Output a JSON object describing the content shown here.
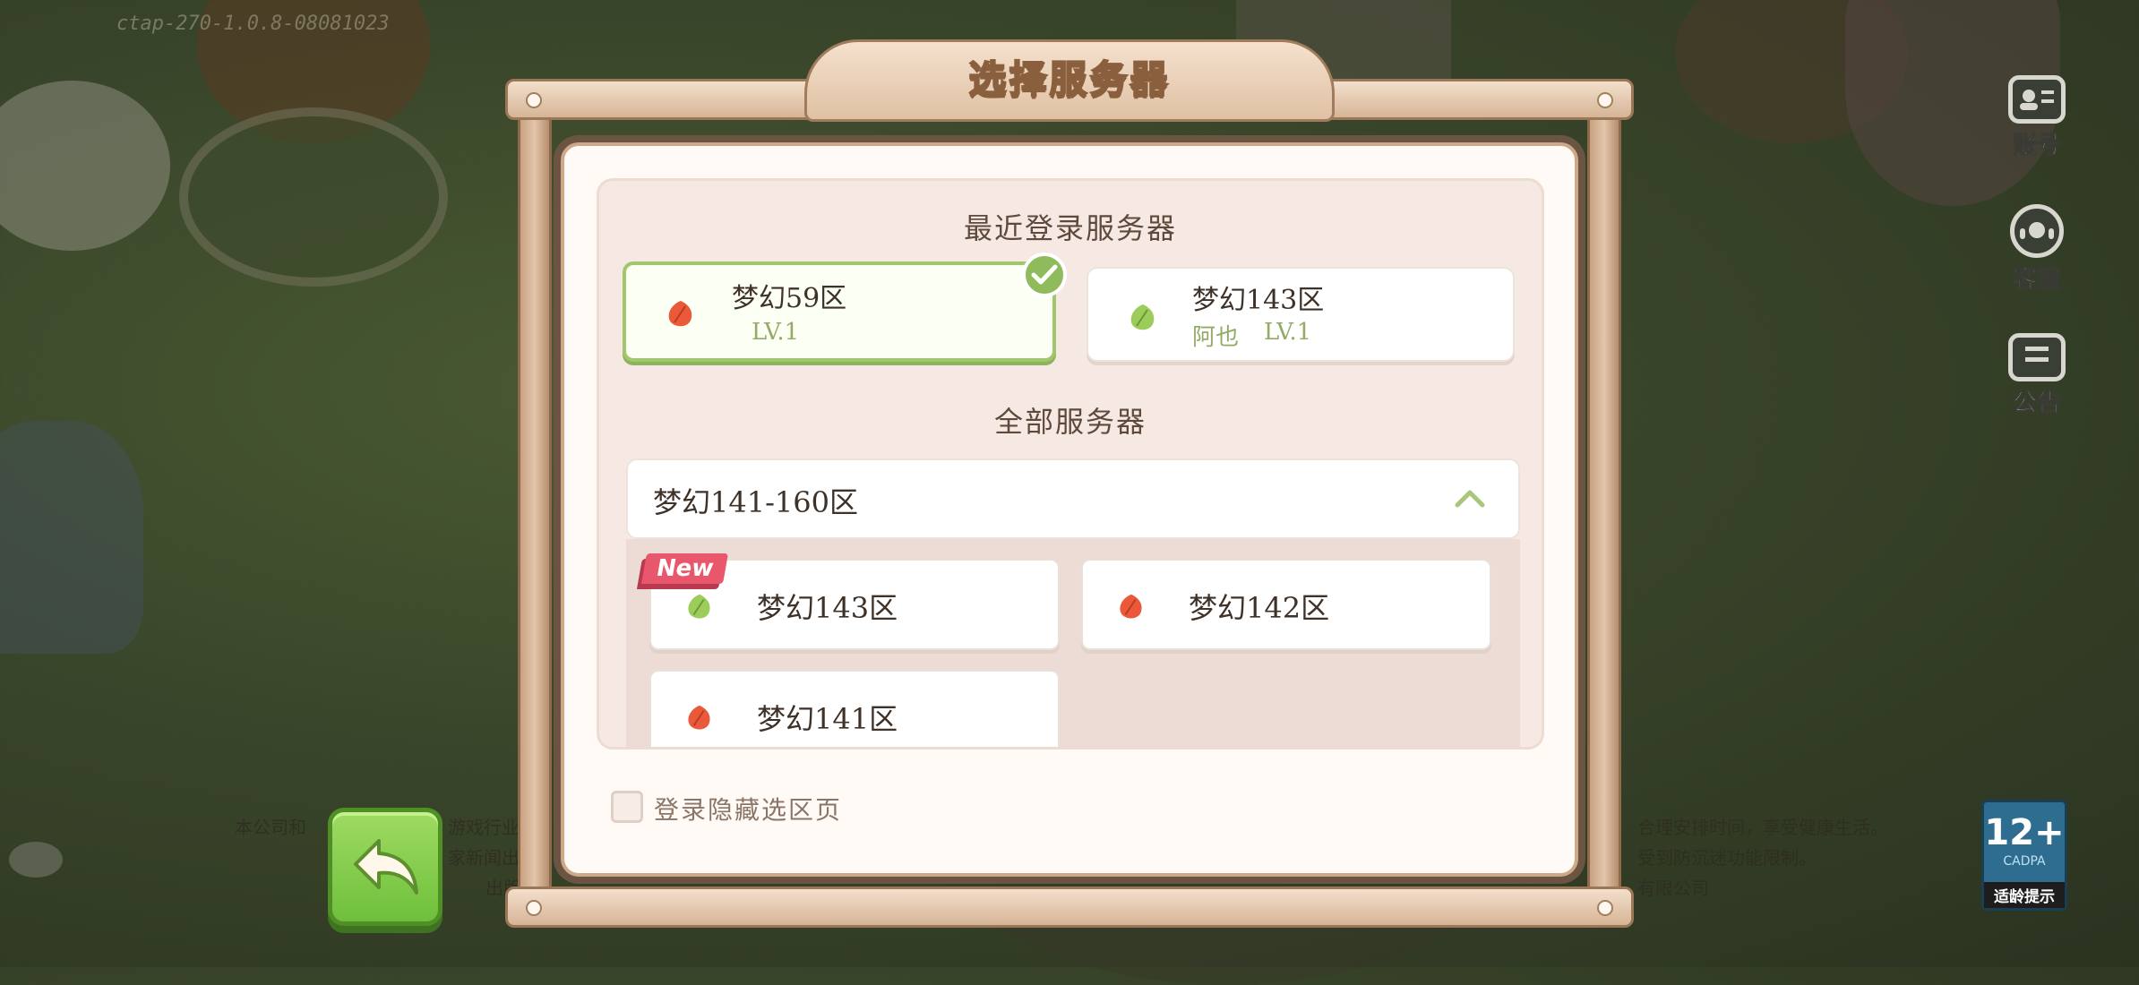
{
  "version": "ctap-270-1.0.8-08081023",
  "disclaimer": {
    "left_line1": "本公司和",
    "left_line1b": "游戏行业",
    "left_line2": "家新闻出",
    "left_line3": "出版",
    "right_line1": "合理安排时间，享受健康生活。",
    "right_line2": "受到防沉迷功能限制。",
    "right_line3": "有限公司"
  },
  "side_menu": {
    "account": "账号",
    "service": "客服",
    "notice": "公告"
  },
  "age_rating": {
    "number": "12+",
    "org": "CADPA",
    "tip": "适龄提示"
  },
  "dialog": {
    "title": "选择服务器",
    "recent_title": "最近登录服务器",
    "recent": [
      {
        "name": "梦幻59区",
        "level": "LV.1",
        "player": "",
        "leaf": "red",
        "selected": true
      },
      {
        "name": "梦幻143区",
        "level": "LV.1",
        "player": "阿也",
        "leaf": "green",
        "selected": false
      }
    ],
    "all_title": "全部服务器",
    "group_label": "梦幻141-160区",
    "servers": [
      {
        "name": "梦幻143区",
        "leaf": "green",
        "tag": "New"
      },
      {
        "name": "梦幻142区",
        "leaf": "red",
        "tag": ""
      },
      {
        "name": "梦幻141区",
        "leaf": "red",
        "tag": ""
      }
    ],
    "hide_label": "登录隐藏选区页"
  }
}
